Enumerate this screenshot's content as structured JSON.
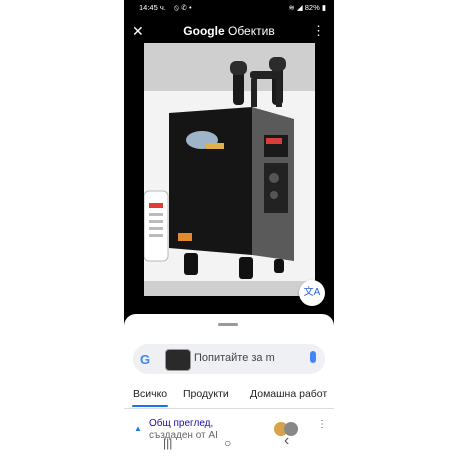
{
  "status_bar": {
    "time": "14:45 ч.",
    "icons_left": "⦸ ✆ •",
    "battery": "82%"
  },
  "app_bar": {
    "brand": "Google",
    "title": "Обектив",
    "close_icon": "✕",
    "more_icon": "⋮"
  },
  "image": {
    "translate_icon": "文A"
  },
  "search": {
    "google_logo": "G",
    "placeholder": "Попитайте за m"
  },
  "tabs": [
    {
      "label": "Всичко",
      "active": true
    },
    {
      "label": "Продукти",
      "active": false
    },
    {
      "label": "Домашна работ",
      "active": false
    }
  ],
  "results": [
    {
      "title": "Общ преглед,",
      "subtitle": "създаден от AI"
    }
  ],
  "nav": {
    "recents": "|||",
    "home": "○",
    "back": "‹"
  }
}
